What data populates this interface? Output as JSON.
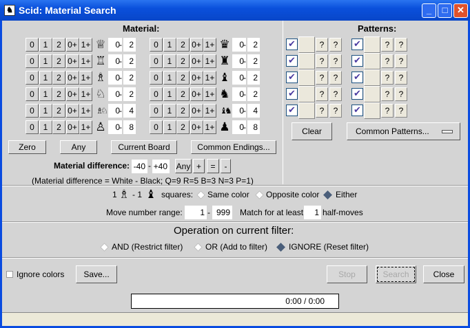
{
  "window": {
    "title": "Scid: Material Search",
    "minimize": "_",
    "maximize": "□",
    "close": "✕"
  },
  "material": {
    "heading": "Material:",
    "count_buttons": [
      "0",
      "1",
      "2",
      "0+",
      "1+"
    ],
    "white_rows": [
      {
        "piece": "white-queen",
        "glyph": "♕",
        "min": "0",
        "max": "2"
      },
      {
        "piece": "white-rook",
        "glyph": "♖",
        "min": "0",
        "max": "2"
      },
      {
        "piece": "white-bishop",
        "glyph": "♗",
        "min": "0",
        "max": "2"
      },
      {
        "piece": "white-knight",
        "glyph": "♘",
        "min": "0",
        "max": "2"
      },
      {
        "piece": "white-minor",
        "glyph": "♗♘",
        "min": "0",
        "max": "4"
      },
      {
        "piece": "white-pawn",
        "glyph": "♙",
        "min": "0",
        "max": "8"
      }
    ],
    "black_rows": [
      {
        "piece": "black-queen",
        "glyph": "♛",
        "min": "0",
        "max": "2"
      },
      {
        "piece": "black-rook",
        "glyph": "♜",
        "min": "0",
        "max": "2"
      },
      {
        "piece": "black-bishop",
        "glyph": "♝",
        "min": "0",
        "max": "2"
      },
      {
        "piece": "black-knight",
        "glyph": "♞",
        "min": "0",
        "max": "2"
      },
      {
        "piece": "black-minor",
        "glyph": "♝♞",
        "min": "0",
        "max": "4"
      },
      {
        "piece": "black-pawn",
        "glyph": "♟",
        "min": "0",
        "max": "8"
      }
    ],
    "dash": "-",
    "zero": "Zero",
    "any": "Any",
    "current_board": "Current Board",
    "common_endings": "Common Endings...",
    "diff_label": "Material difference:",
    "diff_min": "-40",
    "diff_max": "+40",
    "diff_any": "Any",
    "diff_plus": "+",
    "diff_eq": "=",
    "diff_minus": "-",
    "diff_note": "(Material difference = White - Black; Q=9 R=5 B=3 N=3 P=1)"
  },
  "patterns": {
    "heading": "Patterns:",
    "rows": 5,
    "q": "?",
    "clear": "Clear",
    "common": "Common Patterns..."
  },
  "bishops": {
    "one_a": "1",
    "sep": "- 1",
    "label": "squares:",
    "same": "Same color",
    "opposite": "Opposite color",
    "either": "Either",
    "selected": "Either"
  },
  "moves": {
    "label": "Move number range:",
    "min": "1",
    "dash": "-",
    "max": "999",
    "match_label": "Match for at least",
    "match_value": "1",
    "suffix": "half-moves"
  },
  "operation": {
    "heading": "Operation on current filter:",
    "and": "AND (Restrict filter)",
    "or": "OR (Add to filter)",
    "ignore": "IGNORE (Reset filter)",
    "selected": "IGNORE"
  },
  "bottom": {
    "ignore_colors": "Ignore colors",
    "save": "Save...",
    "stop": "Stop",
    "search": "Search",
    "close": "Close"
  },
  "progress": {
    "text": "0:00 / 0:00",
    "fraction": 0
  }
}
